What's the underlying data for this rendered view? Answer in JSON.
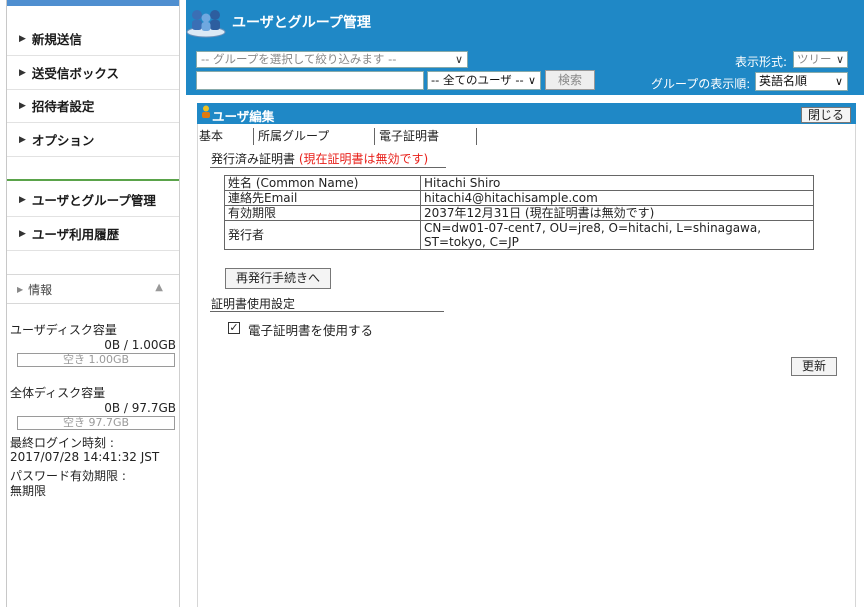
{
  "sidebar": {
    "items": [
      {
        "label": "新規送信"
      },
      {
        "label": "送受信ボックス"
      },
      {
        "label": "招待者設定"
      },
      {
        "label": "オプション"
      },
      {
        "label": "ユーザとグループ管理"
      },
      {
        "label": "ユーザ利用履歴"
      }
    ],
    "info": {
      "heading": "情報",
      "user_disk_label": "ユーザディスク容量",
      "user_disk_value": "0B / 1.00GB",
      "user_disk_free": "空き 1.00GB",
      "total_disk_label": "全体ディスク容量",
      "total_disk_value": "0B / 97.7GB",
      "total_disk_free": "空き 97.7GB",
      "last_login_label": "最終ログイン時刻 :",
      "last_login_value": "2017/07/28 14:41:32 JST",
      "pw_expire_label": "パスワード有効期限 :",
      "pw_expire_value": "無期限"
    }
  },
  "header": {
    "title": "ユーザとグループ管理",
    "group_select_placeholder": "-- グループを選択して絞り込みます --",
    "user_filter": "-- 全てのユーザ --",
    "search_button": "検索",
    "view_label": "表示形式:",
    "view_value": "ツリー",
    "group_order_label": "グループの表示順:",
    "group_order_value": "英語名順"
  },
  "panel": {
    "title": "ユーザ編集",
    "close_button": "閉じる",
    "tabs": [
      {
        "label": "基本"
      },
      {
        "label": "所属グループ"
      },
      {
        "label": "電子証明書"
      }
    ],
    "issued_cert_title": "発行済み証明書",
    "issued_cert_status": "(現在証明書は無効です)",
    "cert_rows": [
      {
        "key": "姓名 (Common Name)",
        "value": "Hitachi Shiro"
      },
      {
        "key": "連絡先Email",
        "value": "hitachi4@hitachisample.com"
      },
      {
        "key": "有効期限",
        "value": "2037年12月31日 (現在証明書は無効です)"
      },
      {
        "key": "発行者",
        "value": "CN=dw01-07-cent7, OU=jre8, O=hitachi, L=shinagawa, ST=tokyo, C=JP"
      }
    ],
    "reissue_button": "再発行手続きへ",
    "cert_usage_title": "証明書使用設定",
    "use_cert_label": "電子証明書を使用する",
    "use_cert_checked": true,
    "update_button": "更新"
  },
  "colors": {
    "header_blue": "#1f88c6",
    "warning_red": "#e8201a",
    "separator_green": "#5aa34a"
  }
}
